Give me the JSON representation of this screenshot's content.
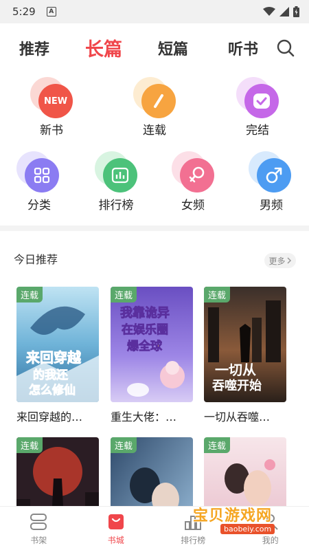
{
  "status": {
    "time": "5:29",
    "app_indicator": "A"
  },
  "tabs": [
    {
      "label": "推荐"
    },
    {
      "label": "长篇"
    },
    {
      "label": "短篇"
    },
    {
      "label": "听书"
    }
  ],
  "categories_row1": [
    {
      "label": "新书",
      "icon": "new-icon",
      "badge_text": "NEW",
      "color": "#f05548",
      "back": "#f6a8a0"
    },
    {
      "label": "连载",
      "icon": "pencil-icon",
      "color": "#f7a440",
      "back": "#fbd49a"
    },
    {
      "label": "完结",
      "icon": "check-icon",
      "color": "#c568e8",
      "back": "#e6b6f5"
    }
  ],
  "categories_row2": [
    {
      "label": "分类",
      "icon": "grid-icon",
      "color": "#8b7cf2",
      "back": "#c9c1fb"
    },
    {
      "label": "排行榜",
      "icon": "bar-chart-icon",
      "color": "#4cc27a",
      "back": "#a8e6bd"
    },
    {
      "label": "女频",
      "icon": "female-icon",
      "color": "#f27092",
      "back": "#f9b8c9"
    },
    {
      "label": "男频",
      "icon": "male-icon",
      "color": "#4d9cf2",
      "back": "#a9d0fa"
    }
  ],
  "section": {
    "title": "今日推荐",
    "more_label": "更多"
  },
  "books": [
    {
      "title": "来回穿越的…",
      "badge": "连载"
    },
    {
      "title": "重生大佬：…",
      "badge": "连载"
    },
    {
      "title": "一切从吞噬…",
      "badge": "连载"
    },
    {
      "title": "",
      "badge": "连载"
    },
    {
      "title": "",
      "badge": "连载"
    },
    {
      "title": "",
      "badge": "连载"
    }
  ],
  "nav": [
    {
      "label": "书架",
      "icon": "bookshelf-icon"
    },
    {
      "label": "书城",
      "icon": "store-icon"
    },
    {
      "label": "排行榜",
      "icon": "ranking-icon"
    },
    {
      "label": "我的",
      "icon": "profile-icon"
    }
  ],
  "watermark": {
    "text": "宝贝游戏网",
    "url": "baobeiy.com"
  },
  "colors": {
    "accent": "#f0464b",
    "badge": "#5aa86b"
  }
}
